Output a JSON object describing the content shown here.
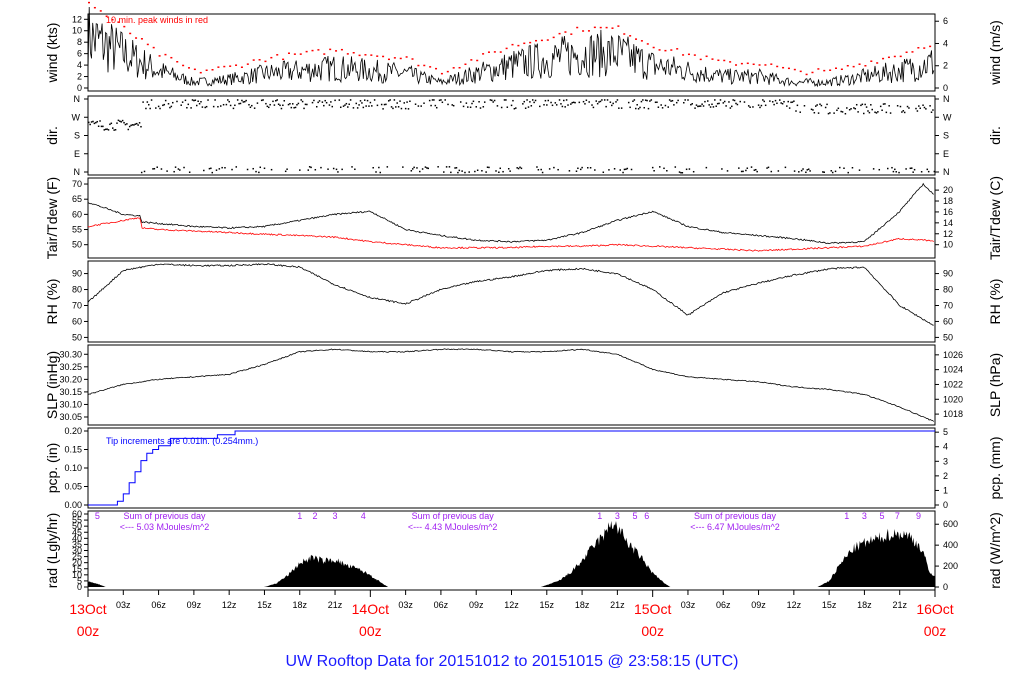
{
  "title": "UW Rooftop Data for 20151012  to  20151015 @ 23:58:15  (UTC)",
  "colors": {
    "peak": "#ff0000",
    "tdew": "#ff0000",
    "pcp": "#0000ff",
    "annot": "#a020f0",
    "title": "#1a1aff"
  },
  "x_axis": {
    "range_hours": [
      0,
      72
    ],
    "hour_ticks": [
      "03z",
      "06z",
      "09z",
      "12z",
      "15z",
      "18z",
      "21z"
    ],
    "dates": [
      {
        "date": "13Oct",
        "time": "00z",
        "hour": 0
      },
      {
        "date": "14Oct",
        "time": "00z",
        "hour": 24
      },
      {
        "date": "15Oct",
        "time": "00z",
        "hour": 48
      },
      {
        "date": "16Oct",
        "time": "00z",
        "hour": 72
      }
    ]
  },
  "chart_data": [
    {
      "type": "line",
      "name": "wind",
      "ylabel": "wind (kts)",
      "ylabel_right": "wind (m/s)",
      "ylim": [
        0,
        13
      ],
      "yticks": [
        0,
        2,
        4,
        6,
        8,
        10,
        12
      ],
      "yticks_right": [
        0,
        2,
        4,
        6
      ],
      "annotation": "10 min. peak winds in red",
      "hours": [
        0,
        3,
        6,
        9,
        12,
        15,
        18,
        21,
        24,
        27,
        30,
        33,
        36,
        39,
        42,
        45,
        48,
        51,
        54,
        57,
        60,
        63,
        66,
        69,
        72
      ],
      "mean_kts": [
        9,
        6,
        3,
        1,
        1.5,
        2.5,
        3,
        3.5,
        3,
        2.5,
        1,
        2.5,
        4,
        5,
        6,
        6,
        4,
        3,
        2,
        2,
        1,
        1,
        2,
        3,
        4.5
      ]
    },
    {
      "type": "scatter",
      "name": "direction",
      "ylabel": "dir.",
      "ylabel_right": "dir.",
      "yticks": [
        "N",
        "W",
        "S",
        "E",
        "N"
      ],
      "segments": [
        {
          "from_hour": 0,
          "to_hour": 4.5,
          "deg": 235
        },
        {
          "from_hour": 4.5,
          "to_hour": 60,
          "deg": 340
        },
        {
          "from_hour": 60,
          "to_hour": 72,
          "deg": 315
        }
      ]
    },
    {
      "type": "line",
      "name": "temperature",
      "ylabel": "Tair/Tdew (F)",
      "ylabel_right": "Tair/Tdew (C)",
      "ylim": [
        46,
        71
      ],
      "yticks": [
        50,
        55,
        60,
        65,
        70
      ],
      "yticks_right": [
        10,
        12,
        14,
        16,
        18,
        20
      ],
      "hours": [
        0,
        3,
        4.4,
        4.6,
        6,
        9,
        12,
        15,
        18,
        21,
        24,
        27,
        30,
        33,
        36,
        39,
        42,
        45,
        48,
        51,
        54,
        57,
        60,
        63,
        66,
        69,
        71,
        72
      ],
      "tair": [
        64,
        60,
        59.5,
        57.5,
        57,
        56,
        55.5,
        56,
        58,
        60,
        61,
        55,
        53,
        51.5,
        51,
        51.5,
        54,
        58,
        61,
        56,
        54,
        53,
        52,
        50.5,
        51,
        61,
        70,
        66
      ],
      "tdew": [
        56,
        58,
        59,
        55.5,
        55,
        54.5,
        54,
        53.5,
        53,
        52.5,
        51,
        50,
        49,
        49,
        49,
        49.5,
        49.5,
        50,
        49.5,
        49,
        48.5,
        48,
        48.5,
        49,
        49.5,
        52,
        51.5,
        51
      ]
    },
    {
      "type": "line",
      "name": "rh",
      "ylabel": "RH (%)",
      "ylabel_right": "RH (%)",
      "ylim": [
        48,
        98
      ],
      "yticks": [
        50,
        60,
        70,
        80,
        90
      ],
      "hours": [
        0,
        3,
        6,
        9,
        12,
        15,
        18,
        21,
        24,
        27,
        30,
        33,
        36,
        39,
        42,
        45,
        48,
        51,
        54,
        57,
        60,
        63,
        66,
        69,
        72
      ],
      "values": [
        72,
        92,
        96,
        95,
        95,
        96,
        94,
        83,
        75,
        71,
        80,
        85,
        88,
        92,
        93,
        90,
        80,
        64,
        78,
        84,
        89,
        93,
        94,
        70,
        57
      ]
    },
    {
      "type": "line",
      "name": "slp",
      "ylabel": "SLP (inHg)",
      "ylabel_right": "SLP (hPa)",
      "ylim": [
        30.02,
        30.33
      ],
      "yticks": [
        30.05,
        30.1,
        30.15,
        30.2,
        30.25,
        30.3
      ],
      "yticks_right": [
        1018,
        1020,
        1022,
        1024,
        1026
      ],
      "hours": [
        0,
        3,
        6,
        9,
        12,
        15,
        18,
        21,
        24,
        27,
        30,
        33,
        36,
        39,
        42,
        45,
        48,
        51,
        54,
        57,
        60,
        63,
        66,
        69,
        72
      ],
      "values": [
        30.14,
        30.18,
        30.2,
        30.21,
        30.22,
        30.26,
        30.31,
        30.32,
        30.31,
        30.31,
        30.32,
        30.32,
        30.31,
        30.31,
        30.32,
        30.3,
        30.24,
        30.21,
        30.2,
        30.19,
        30.17,
        30.16,
        30.14,
        30.09,
        30.03
      ]
    },
    {
      "type": "line",
      "name": "precip",
      "ylabel": "pcp. (in)",
      "ylabel_right": "pcp. (mm)",
      "ylim": [
        0,
        0.2
      ],
      "yticks": [
        0.0,
        0.05,
        0.1,
        0.15,
        0.2
      ],
      "yticks_right": [
        0,
        1,
        2,
        3,
        4,
        5
      ],
      "annotation": "Tip increments are 0.01in. (0.254mm.)",
      "hours": [
        0,
        2.5,
        3,
        3.5,
        4,
        4.5,
        5,
        5.5,
        6,
        7,
        11,
        12.5,
        72
      ],
      "values": [
        0,
        0.01,
        0.03,
        0.06,
        0.09,
        0.12,
        0.14,
        0.15,
        0.16,
        0.18,
        0.19,
        0.2,
        0.2
      ]
    },
    {
      "type": "area",
      "name": "radiation",
      "ylabel": "rad (Lgly/hr)",
      "ylabel_right": "rad (W/m^2)",
      "ylim": [
        0,
        60
      ],
      "yticks": [
        0,
        5,
        10,
        15,
        20,
        25,
        30,
        35,
        40,
        45,
        50,
        55,
        60
      ],
      "yticks_right": [
        0,
        200,
        400,
        600
      ],
      "hours": [
        0,
        1,
        1.5,
        15,
        16,
        17,
        18,
        19,
        20,
        21,
        22,
        23,
        24,
        25,
        25.5,
        38.5,
        40,
        41,
        42,
        43,
        44,
        44.5,
        45,
        46,
        47,
        48,
        49,
        49.5,
        62,
        63,
        64,
        65,
        66,
        67,
        68,
        69,
        70,
        71,
        71.5,
        72
      ],
      "values": [
        5,
        2,
        0,
        0,
        3,
        10,
        20,
        25,
        22,
        23,
        18,
        15,
        10,
        3,
        0,
        0,
        5,
        12,
        22,
        35,
        45,
        55,
        50,
        36,
        25,
        12,
        3,
        0,
        0,
        5,
        20,
        32,
        37,
        40,
        44,
        45,
        42,
        30,
        12,
        10
      ],
      "hour_labels": [
        {
          "t": "5",
          "h": 0.8
        },
        {
          "t": "1",
          "h": 18
        },
        {
          "t": "2",
          "h": 19.3
        },
        {
          "t": "3",
          "h": 21
        },
        {
          "t": "4",
          "h": 23.4
        },
        {
          "t": "1",
          "h": 43.5
        },
        {
          "t": "3",
          "h": 45
        },
        {
          "t": "5",
          "h": 46.5
        },
        {
          "t": "6",
          "h": 47.5
        },
        {
          "t": "1",
          "h": 64.5
        },
        {
          "t": "3",
          "h": 66
        },
        {
          "t": "5",
          "h": 67.5
        },
        {
          "t": "7",
          "h": 68.8
        },
        {
          "t": "9",
          "h": 70.6
        }
      ],
      "daily_sums": [
        {
          "line1": "Sum of previous day",
          "line2": "<--- 5.03 MJoules/m^2",
          "h": 6.5
        },
        {
          "line1": "Sum of previous day",
          "line2": "<--- 4.43 MJoules/m^2",
          "h": 31
        },
        {
          "line1": "Sum of previous day",
          "line2": "<--- 6.47 MJoules/m^2",
          "h": 55
        }
      ]
    }
  ]
}
